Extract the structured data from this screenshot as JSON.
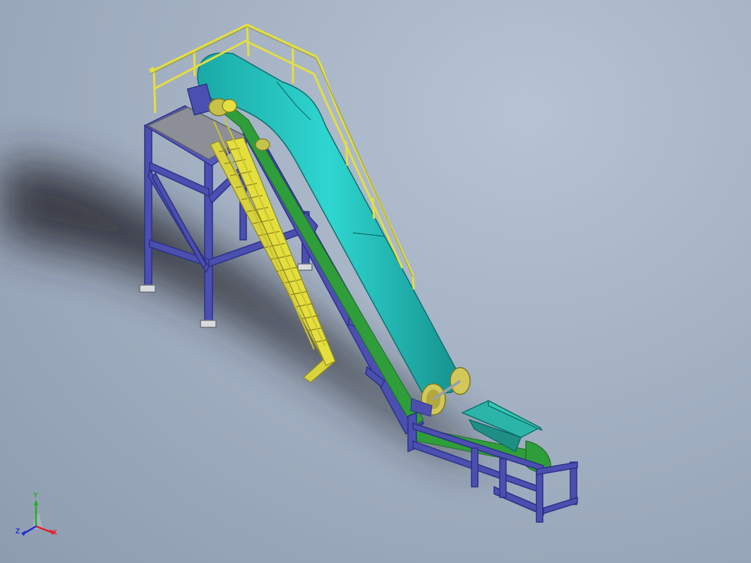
{
  "viewport": {
    "background": "#a3b1c3"
  },
  "model": {
    "colors": {
      "frame": "#4b4fb0",
      "frame_dark": "#2e3185",
      "belt": "#26c9c4",
      "belt_dark": "#12918f",
      "chain": "#2f9e3a",
      "rail": "#e4df3e",
      "rail_dark": "#9c9620",
      "platform": "#8c9096",
      "shadow": "#2a2c32",
      "hopper": "#2bb5a8"
    }
  },
  "triad": {
    "x_label": "X",
    "y_label": "Y",
    "z_label": "Z",
    "x_color": "#e02020",
    "y_color": "#20b020",
    "z_color": "#2030d0"
  }
}
